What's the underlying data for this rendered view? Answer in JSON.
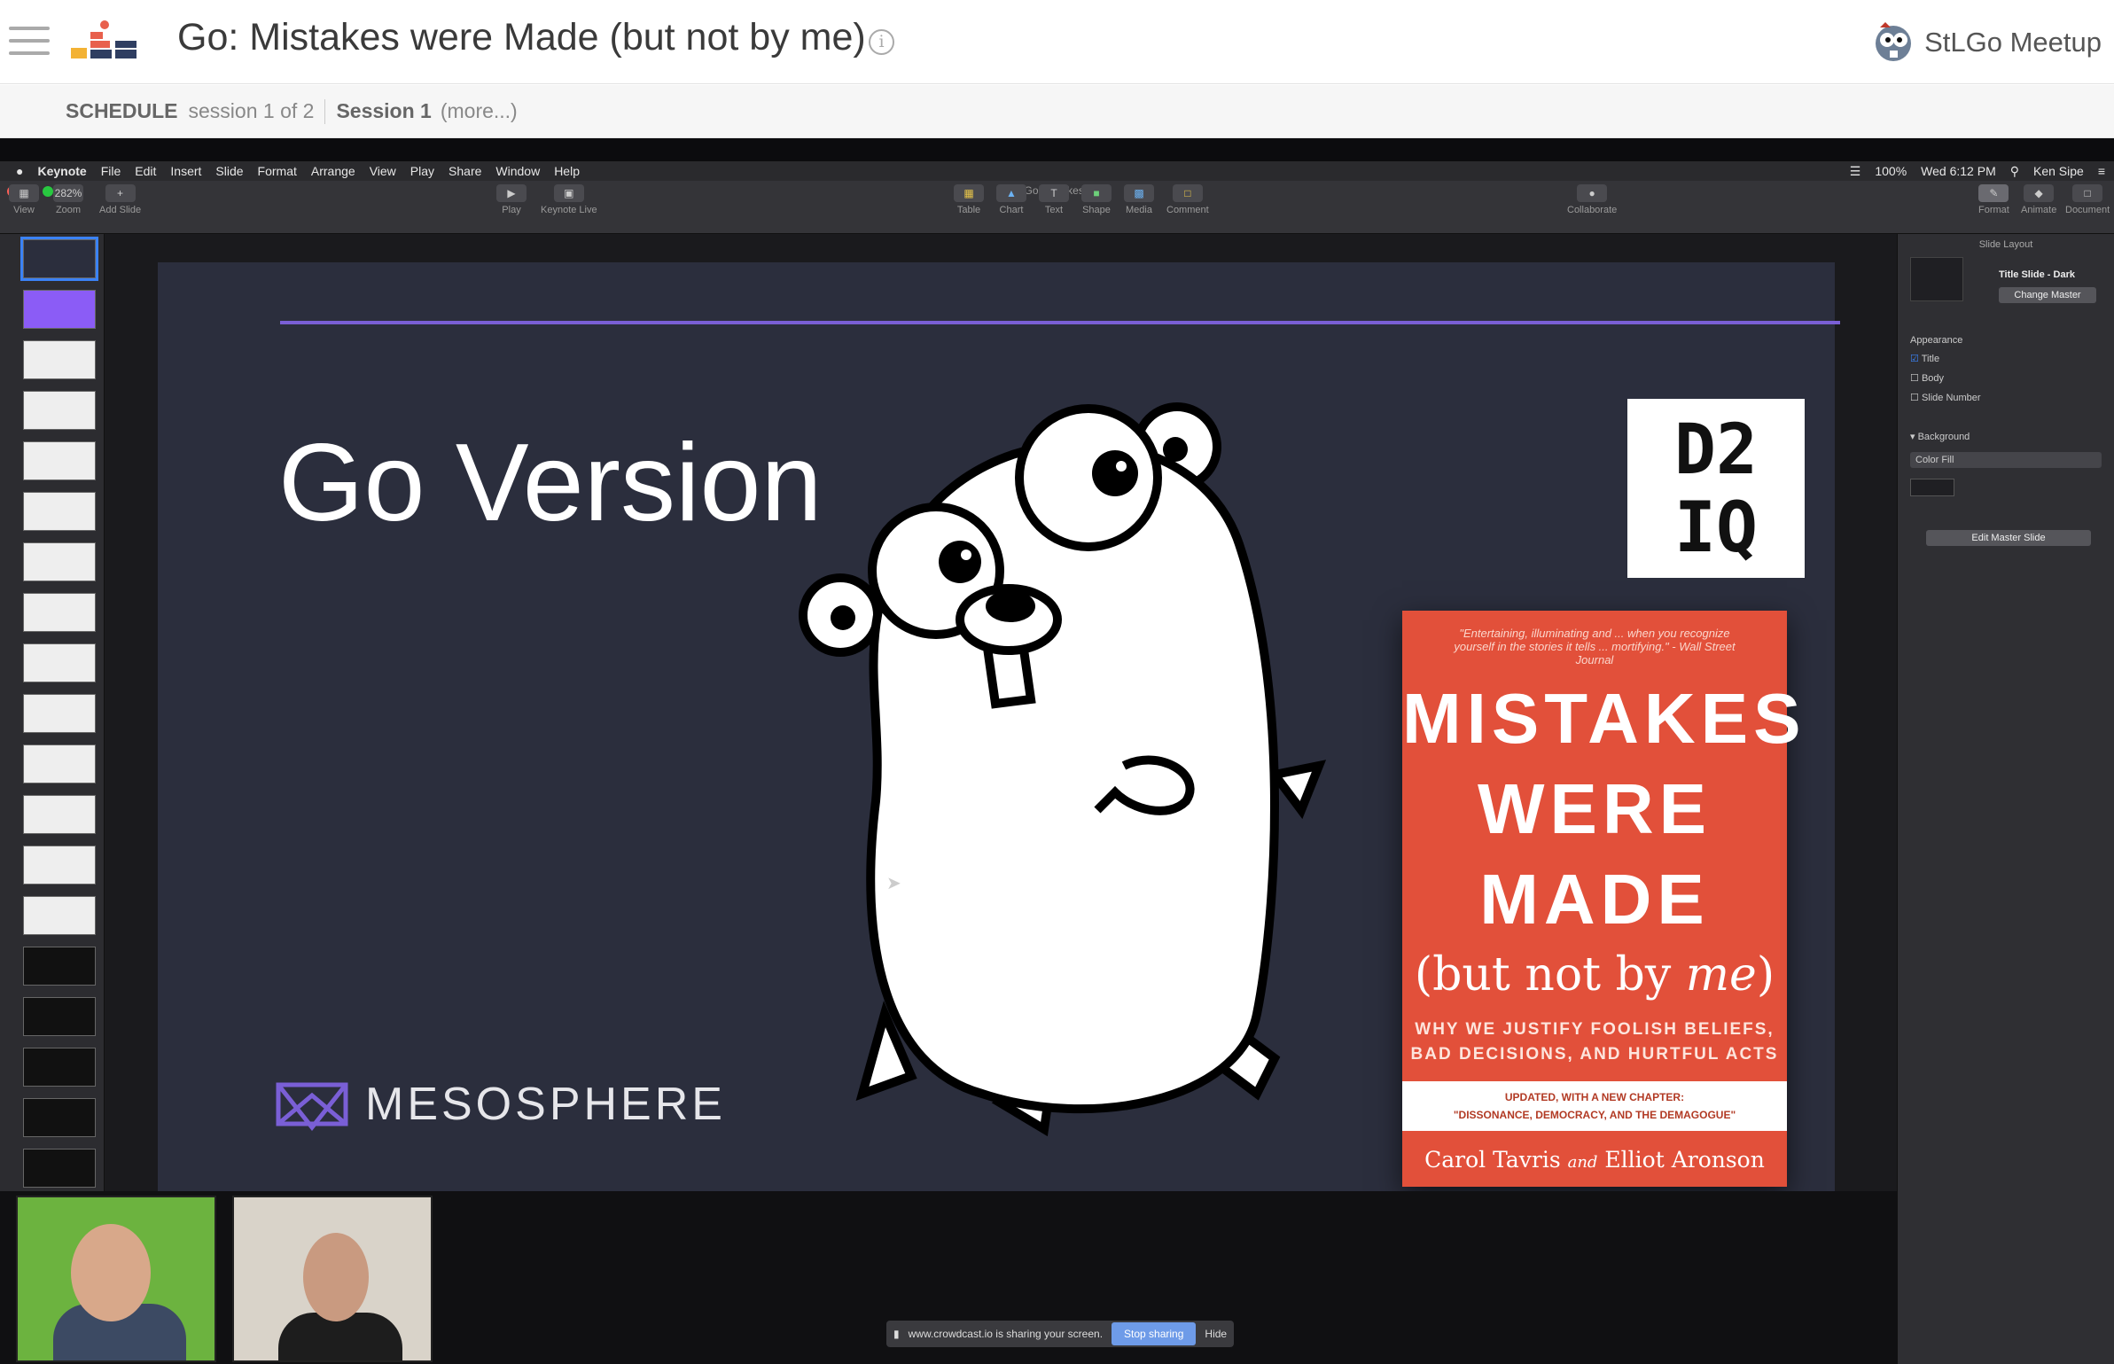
{
  "header": {
    "title": "Go: Mistakes were Made (but not by me)",
    "host_name": "StLGo Meetup"
  },
  "schedule": {
    "label": "SCHEDULE",
    "session_count": "session 1 of 2",
    "session_name": "Session 1",
    "more": "(more...)"
  },
  "mac_menu": {
    "app": "Keynote",
    "items": [
      "File",
      "Edit",
      "Insert",
      "Slide",
      "Format",
      "Arrange",
      "View",
      "Play",
      "Share",
      "Window",
      "Help"
    ],
    "status_battery": "100%",
    "status_time": "Wed 6:12 PM",
    "status_user": "Ken Sipe"
  },
  "keynote": {
    "doc_title": "Go-Mistakes2",
    "toolbar_left": [
      "View",
      "Zoom",
      "Add Slide"
    ],
    "zoom_value": "282%",
    "toolbar_play": [
      "Play",
      "Keynote Live"
    ],
    "toolbar_center": [
      "Table",
      "Chart",
      "Text",
      "Shape",
      "Media",
      "Comment"
    ],
    "toolbar_collab": "Collaborate",
    "toolbar_right": [
      "Format",
      "Animate",
      "Document"
    ]
  },
  "inspector": {
    "heading": "Slide Layout",
    "layout_name": "Title Slide - Dark",
    "change_master": "Change Master",
    "appearance": "Appearance",
    "opt_title": "Title",
    "opt_body": "Body",
    "opt_slide_number": "Slide Number",
    "background": "Background",
    "fill": "Color Fill",
    "edit_master": "Edit Master Slide"
  },
  "slide": {
    "title": "Go Version",
    "logo_top": "D2",
    "logo_bottom": "IQ",
    "sponsor": "MESOSPHERE",
    "book": {
      "blurb": "\"Entertaining, illuminating and ... when you recognize yourself in the stories it tells ... mortifying.\" - Wall Street Journal",
      "line1": "MISTAKES",
      "line2": "WERE",
      "line3": "MADE",
      "subtitle_a": "(but not by ",
      "subtitle_b": "me",
      "subtitle_c": ")",
      "why1": "WHY WE JUSTIFY FOOLISH BELIEFS,",
      "why2": "BAD DECISIONS, AND HURTFUL ACTS",
      "band1": "UPDATED, WITH A NEW CHAPTER:",
      "band2": "\"DISSONANCE, DEMOCRACY, AND THE DEMAGOGUE\"",
      "authors_a": "Carol Tavris ",
      "authors_and": "and",
      "authors_b": " Elliot Aronson"
    }
  },
  "screenshare": {
    "notice": "www.crowdcast.io is sharing your screen.",
    "stop": "Stop sharing",
    "hide": "Hide"
  },
  "colors": {
    "accent_purple": "#7a5fd6",
    "book_red": "#e2503a",
    "slide_bg": "#2b2e3d"
  }
}
